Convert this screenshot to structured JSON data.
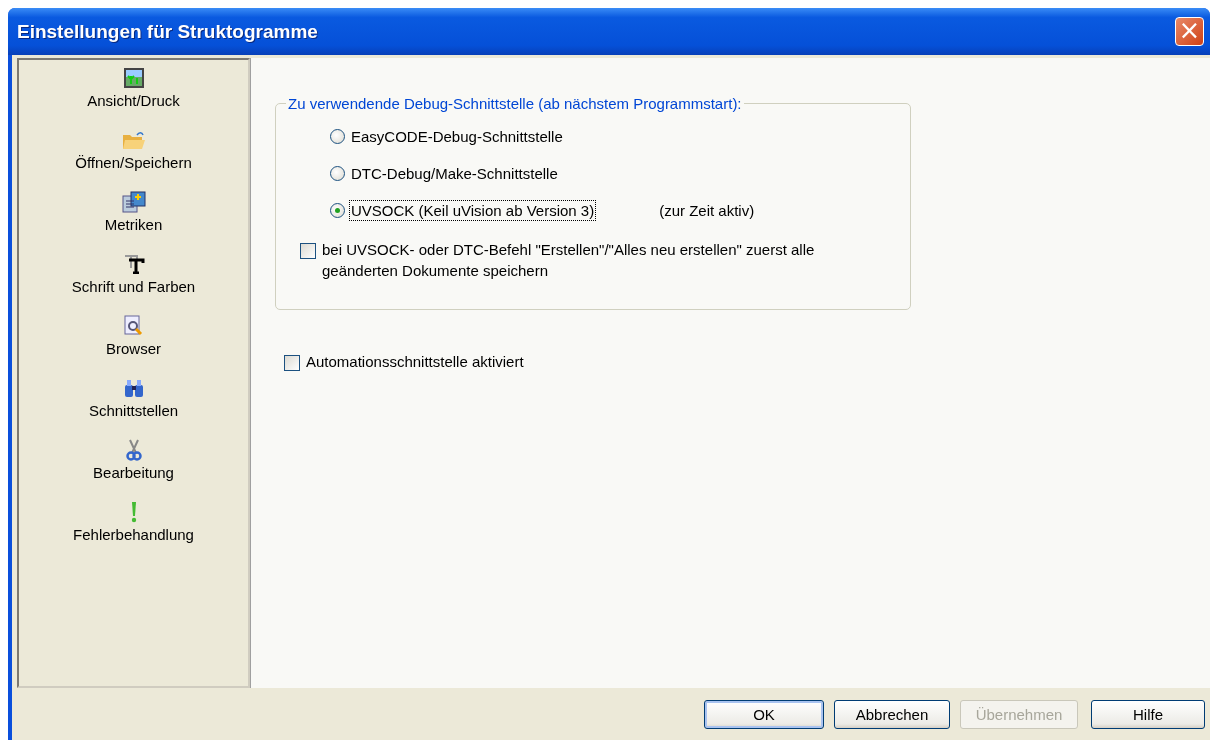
{
  "window": {
    "title": "Einstellungen für Struktogramme",
    "close": "×"
  },
  "sidebar": {
    "items": [
      {
        "label": "Ansicht/Druck"
      },
      {
        "label": "Öffnen/Speichern"
      },
      {
        "label": "Metriken"
      },
      {
        "label": "Schrift und Farben"
      },
      {
        "label": "Browser"
      },
      {
        "label": "Schnittstellen"
      },
      {
        "label": "Bearbeitung"
      },
      {
        "label": "Fehlerbehandlung"
      }
    ]
  },
  "debug_group": {
    "legend": "Zu verwendende Debug-Schnittstelle (ab nächstem Programmstart):",
    "options": [
      {
        "label": "EasyCODE-Debug-Schnittstelle",
        "selected": false
      },
      {
        "label": "DTC-Debug/Make-Schnittstelle",
        "selected": false
      },
      {
        "label": "UVSOCK (Keil uVision ab Version 3)",
        "selected": true,
        "note": "(zur Zeit aktiv)"
      }
    ],
    "save_first": {
      "label": "bei UVSOCK- oder DTC-Befehl \"Erstellen\"/\"Alles neu erstellen\" zuerst alle geänderten Dokumente speichern",
      "checked": false
    }
  },
  "automation": {
    "label": "Automationsschnittstelle aktiviert",
    "checked": false
  },
  "buttons": [
    {
      "label": "OK",
      "disabled": false,
      "default": true
    },
    {
      "label": "Abbrechen",
      "disabled": false,
      "default": false
    },
    {
      "label": "Übernehmen",
      "disabled": true,
      "default": false
    },
    {
      "label": "Hilfe",
      "disabled": false,
      "default": false
    }
  ]
}
